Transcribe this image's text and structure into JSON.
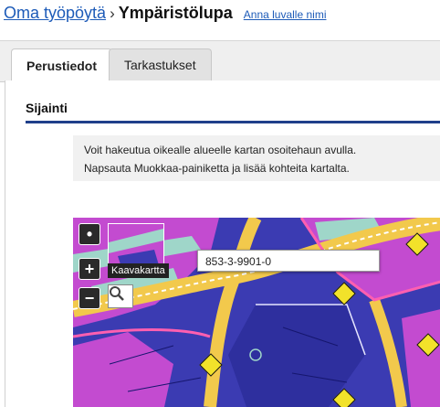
{
  "breadcrumb": {
    "home_label": "Oma työpöytä",
    "separator": "›",
    "title": "Ympäristölupa",
    "rename_label": "Anna luvalle nimi"
  },
  "tabs": [
    {
      "label": "Perustiedot",
      "active": true
    },
    {
      "label": "Tarkastukset",
      "active": false
    }
  ],
  "section": {
    "title": "Sijainti",
    "info_lines": [
      "Voit hakeutua oikealle alueelle kartan osoitehaun avulla.",
      "Napsauta Muokkaa-painiketta ja lisää kohteita kartalta."
    ]
  },
  "map": {
    "controls": {
      "locate": "•",
      "zoom_in": "+",
      "zoom_out": "−"
    },
    "layer_label": "Kaavakartta",
    "parcel_id": "853-3-9901-0",
    "search_icon": "magnifier-icon",
    "colors": {
      "residential": "#3b3bb2",
      "commercial": "#c34bd0",
      "road": "#f2c94c",
      "park": "#9fd6c9",
      "highlight": "#1d5bb8"
    }
  }
}
